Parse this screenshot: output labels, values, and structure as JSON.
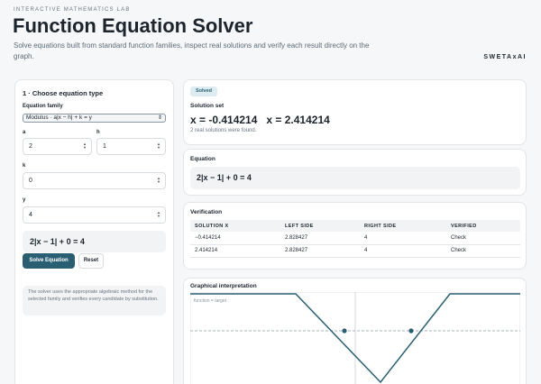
{
  "header": {
    "eyebrow": "INTERACTIVE MATHEMATICS LAB",
    "title": "Function Equation Solver",
    "subtitle": "Solve equations built from standard function families, inspect real solutions and verify each result directly on the graph.",
    "brand": "SWETAxAI"
  },
  "controls": {
    "section_title": "1 · Choose equation type",
    "family_label": "Equation family",
    "family_value": "Modulus · a|x − h| + k = y",
    "param_a_label": "a",
    "param_a_value": "2",
    "param_h_label": "h",
    "param_h_value": "1",
    "param_k_label": "k",
    "param_k_value": "0",
    "param_y_label": "y",
    "param_y_value": "4",
    "equation_preview": "2|x − 1| + 0 = 4",
    "solve_label": "Solve Equation",
    "reset_label": "Reset",
    "note": "The solver uses the appropriate algebraic method for the selected family and verifies every candidate by substitution."
  },
  "solution": {
    "badge": "Solved",
    "title": "Solution set",
    "value": "x = -0.414214   x = 2.414214",
    "count_text": "2 real solutions were found."
  },
  "equation_card": {
    "title": "Equation",
    "value": "2|x − 1| + 0 = 4"
  },
  "verification": {
    "title": "Verification",
    "columns": [
      "SOLUTION X",
      "LEFT SIDE",
      "RIGHT SIDE",
      "VERIFIED"
    ],
    "rows": [
      [
        "−0.414214",
        "2.828427",
        "4",
        "Check"
      ],
      [
        "2.414214",
        "2.828427",
        "4",
        "Check"
      ]
    ]
  },
  "graph": {
    "title": "Graphical interpretation",
    "legend_text": "function = target"
  },
  "colors": {
    "accent": "#2a5f73",
    "badge_bg": "#dcecf0",
    "page_bg": "#f6f7f8"
  }
}
